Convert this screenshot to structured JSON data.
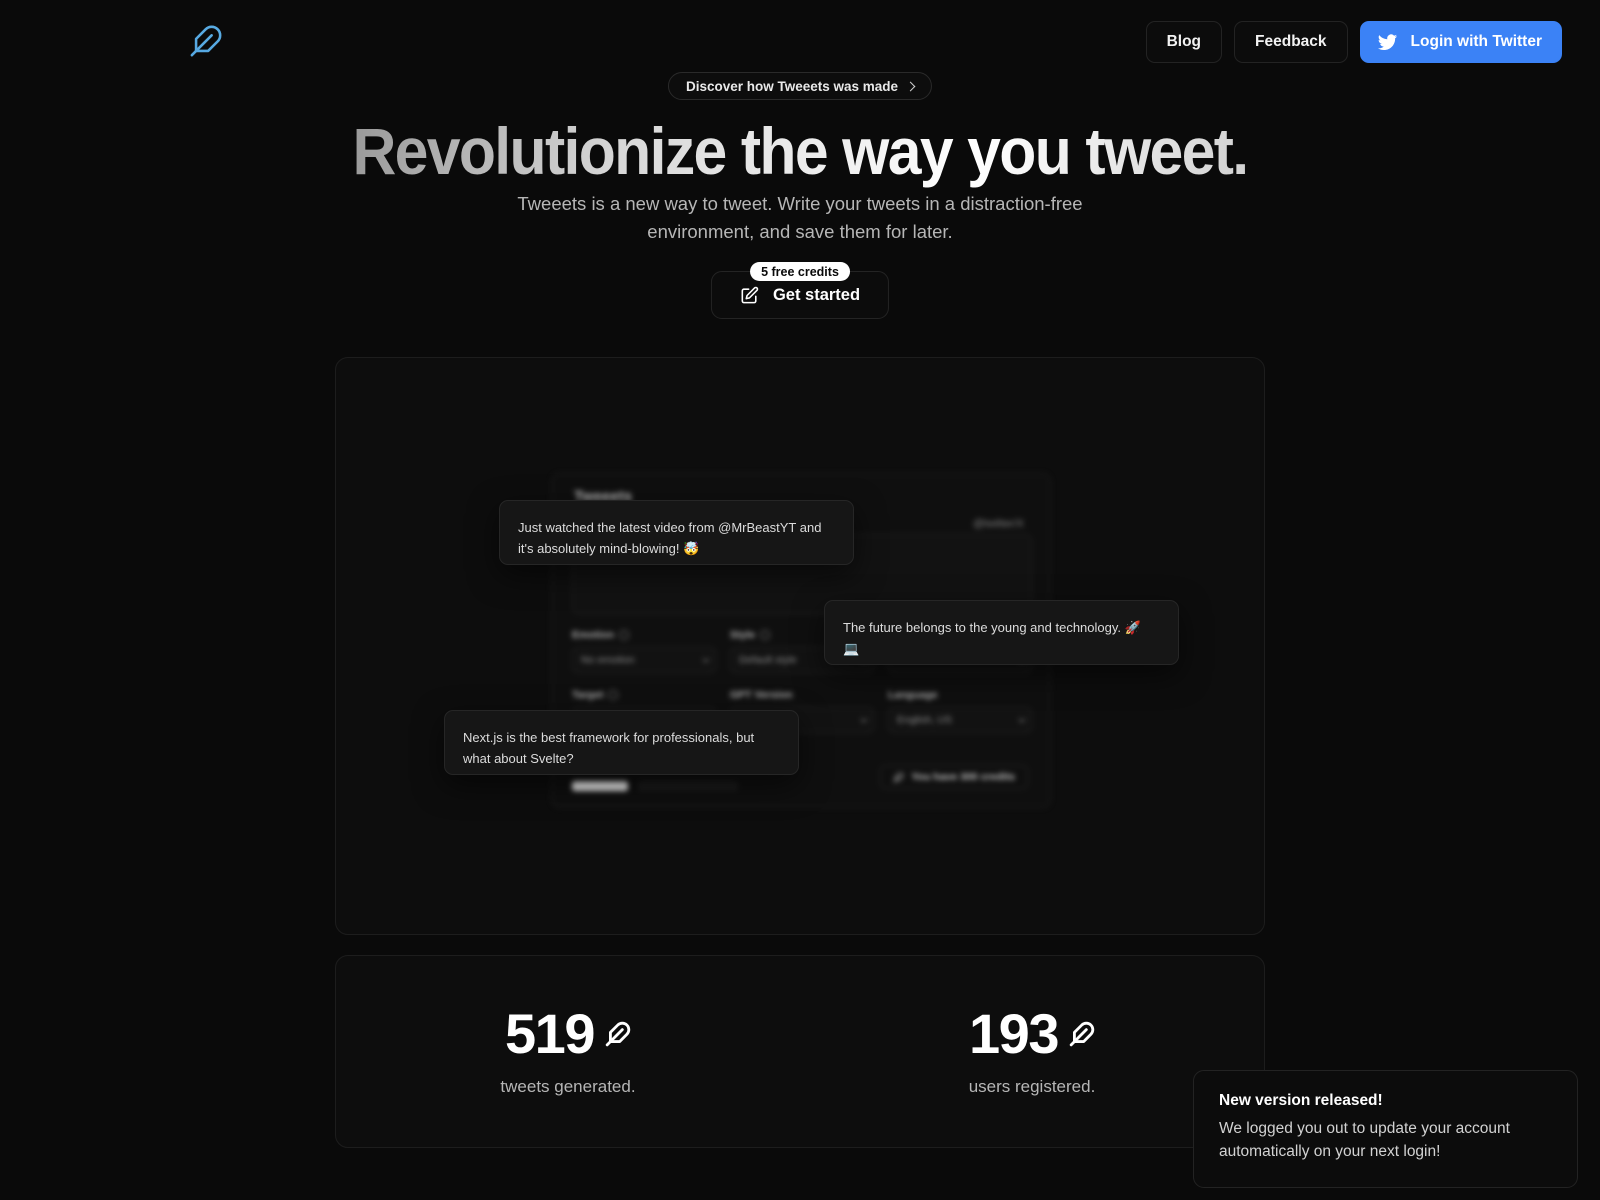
{
  "header": {
    "logo_icon": "feather-icon",
    "nav": [
      {
        "label": "Blog",
        "name": "blog"
      },
      {
        "label": "Feedback",
        "name": "feedback"
      }
    ],
    "twitter_login": {
      "label": "Login with Twitter",
      "icon": "twitter-bird-icon",
      "color": "#3b82f6"
    }
  },
  "hero": {
    "discover_pill": "Discover how Tweeets was made",
    "discover_icon": "chevron-right-icon",
    "headline": "Revolutionize the way you tweet.",
    "subtitle": "Tweeets is a new way to tweet. Write your tweets in a distraction-free environment, and save them for later.",
    "credits_badge": "5 free credits",
    "cta_label": "Get started",
    "cta_icon": "pencil-square-icon"
  },
  "demo": {
    "app": {
      "title": "Tweeets",
      "handle": "@twitter/X",
      "textarea_placeholder": "Enter your tweet content here",
      "fields": [
        {
          "label": "Emotion",
          "value": "No emotion",
          "has_help": true
        },
        {
          "label": "Style",
          "value": "Default style",
          "has_help": true
        },
        {
          "label": "Target",
          "value": "",
          "has_help": true
        },
        {
          "label": "GPT Version",
          "value": "",
          "has_help": false
        },
        {
          "label": "Language",
          "value": "English, US",
          "has_help": false
        }
      ],
      "credits_text": "You have 300 credits",
      "credits_icon": "feather-icon"
    },
    "floating_tweets": [
      "Just watched the latest video from @MrBeastYT and it's absolutely mind-blowing! 🤯",
      "The future belongs to the young and technology. 🚀 💻",
      "Next.js is the best framework for professionals, but what about Svelte?"
    ]
  },
  "stats": [
    {
      "number": "519",
      "glyph": "✦",
      "label": "tweets generated."
    },
    {
      "number": "193",
      "glyph": "✦",
      "label": "users registered."
    }
  ],
  "toast": {
    "title": "New version released!",
    "body": "We logged you out to update your account automatically on your next login!"
  }
}
